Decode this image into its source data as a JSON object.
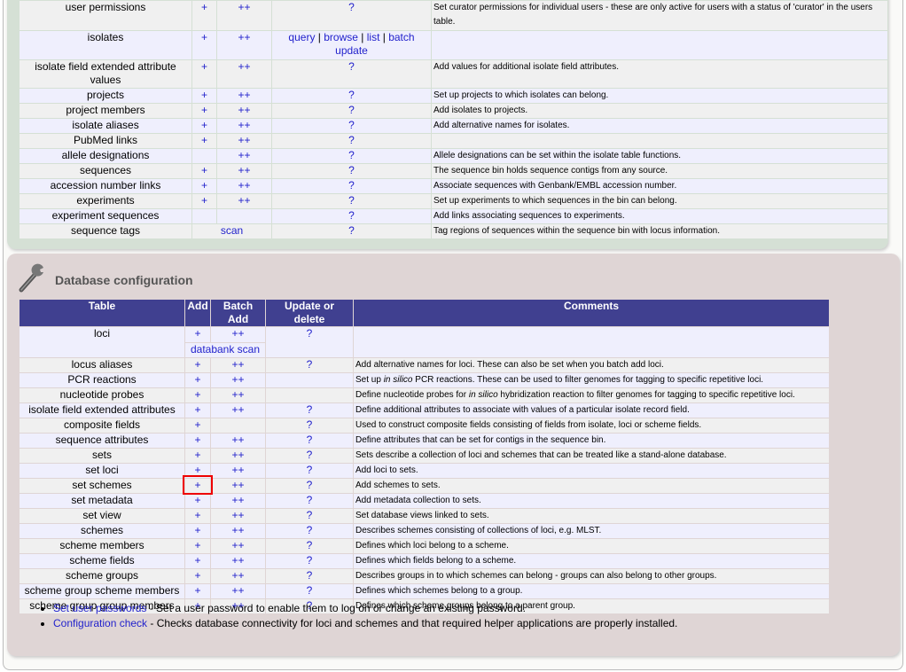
{
  "curator_table": {
    "rows": [
      {
        "table": "user permissions",
        "add": "+",
        "batch": "++",
        "update": "?",
        "comment": "Set curator permissions for individual users - these are only active for users with a status of 'curator' in the users table.",
        "h": 34
      },
      {
        "table": "isolates",
        "add": "+",
        "batch": "++",
        "update_links": [
          "query",
          "browse",
          "list",
          "batch update"
        ],
        "comment": "",
        "h": 33
      },
      {
        "table": "isolate field extended attribute values",
        "add": "+",
        "batch": "++",
        "update": "?",
        "comment": "Add values for additional isolate field attributes.",
        "h": 32
      },
      {
        "table": "projects",
        "add": "+",
        "batch": "++",
        "update": "?",
        "comment": "Set up projects to which isolates can belong."
      },
      {
        "table": "project members",
        "add": "+",
        "batch": "++",
        "update": "?",
        "comment": "Add isolates to projects."
      },
      {
        "table": "isolate aliases",
        "add": "+",
        "batch": "++",
        "update": "?",
        "comment": "Add alternative names for isolates."
      },
      {
        "table": "PubMed links",
        "add": "+",
        "batch": "++",
        "update": "?",
        "comment": ""
      },
      {
        "table": "allele designations",
        "add": "",
        "batch": "++",
        "update": "?",
        "comment": "Allele designations can be set within the isolate table functions."
      },
      {
        "table": "sequences",
        "add": "+",
        "batch": "++",
        "update": "?",
        "comment": "The sequence bin holds sequence contigs from any source."
      },
      {
        "table": "accession number links",
        "add": "+",
        "batch": "++",
        "update": "?",
        "comment": "Associate sequences with Genbank/EMBL accession number."
      },
      {
        "table": "experiments",
        "add": "+",
        "batch": "++",
        "update": "?",
        "comment": "Set up experiments to which sequences in the bin can belong."
      },
      {
        "table": "experiment sequences",
        "add": "",
        "batch": "",
        "update": "?",
        "comment": "Add links associating sequences to experiments."
      },
      {
        "table": "sequence tags",
        "span": "scan",
        "update": "?",
        "comment": "Tag regions of sequences within the sequence bin with locus information."
      }
    ]
  },
  "db_config": {
    "title": "Database configuration",
    "icon": "wrench-icon",
    "headers": [
      "Table",
      "Add",
      "Batch Add",
      "Update or delete",
      "Comments"
    ],
    "loci": {
      "table": "loci",
      "add": "+",
      "batch": "++",
      "update": "?",
      "extra": "databank scan",
      "comment": ""
    },
    "rows": [
      {
        "table": "locus aliases",
        "add": "+",
        "batch": "++",
        "update": "?",
        "comment": "Add alternative names for loci. These can also be set when you batch add loci."
      },
      {
        "table": "PCR reactions",
        "add": "+",
        "batch": "++",
        "update": "",
        "comment_pre": "Set up ",
        "comment_it": "in silico",
        "comment_post": " PCR reactions. These can be used to filter genomes for tagging to specific repetitive loci."
      },
      {
        "table": "nucleotide probes",
        "add": "+",
        "batch": "++",
        "update": "",
        "comment_pre": "Define nucleotide probes for ",
        "comment_it": "in silico",
        "comment_post": " hybridization reaction to filter genomes for tagging to specific repetitive loci."
      },
      {
        "table": "isolate field extended attributes",
        "add": "+",
        "batch": "++",
        "update": "?",
        "comment": "Define additional attributes to associate with values of a particular isolate record field."
      },
      {
        "table": "composite fields",
        "add": "+",
        "batch": "",
        "update": "?",
        "comment": "Used to construct composite fields consisting of fields from isolate, loci or scheme fields."
      },
      {
        "table": "sequence attributes",
        "add": "+",
        "batch": "++",
        "update": "?",
        "comment": "Define attributes that can be set for contigs in the sequence bin."
      },
      {
        "table": "sets",
        "add": "+",
        "batch": "++",
        "update": "?",
        "comment": "Sets describe a collection of loci and schemes that can be treated like a stand-alone database."
      },
      {
        "table": "set loci",
        "add": "+",
        "batch": "++",
        "update": "?",
        "comment": "Add loci to sets."
      },
      {
        "table": "set schemes",
        "add": "+",
        "batch": "++",
        "update": "?",
        "comment": "Add schemes to sets."
      },
      {
        "table": "set metadata",
        "add": "+",
        "batch": "++",
        "update": "?",
        "comment": "Add metadata collection to sets.",
        "highlight": true
      },
      {
        "table": "set view",
        "add": "+",
        "batch": "++",
        "update": "?",
        "comment": "Set database views linked to sets."
      },
      {
        "table": "schemes",
        "add": "+",
        "batch": "++",
        "update": "?",
        "comment": "Describes schemes consisting of collections of loci, e.g. MLST."
      },
      {
        "table": "scheme members",
        "add": "+",
        "batch": "++",
        "update": "?",
        "comment": "Defines which loci belong to a scheme."
      },
      {
        "table": "scheme fields",
        "add": "+",
        "batch": "++",
        "update": "?",
        "comment": "Defines which fields belong to a scheme."
      },
      {
        "table": "scheme groups",
        "add": "+",
        "batch": "++",
        "update": "?",
        "comment": "Describes groups in to which schemes can belong - groups can also belong to other groups."
      },
      {
        "table": "scheme group scheme members",
        "add": "+",
        "batch": "++",
        "update": "?",
        "comment": "Defines which schemes belong to a group."
      },
      {
        "table": "scheme group group members",
        "add": "+",
        "batch": "++",
        "update": "?",
        "comment": "Defines which scheme groups belong to a parent group."
      }
    ],
    "links": [
      {
        "label": "Set user passwords",
        "text": " - Set a user password to enable them to log on or change an existing password."
      },
      {
        "label": "Configuration check",
        "text": " - Checks database connectivity for loci and schemes and that required helper applications are properly installed."
      }
    ],
    "highlight_color": "#ee0000",
    "header_color": "#404090"
  }
}
